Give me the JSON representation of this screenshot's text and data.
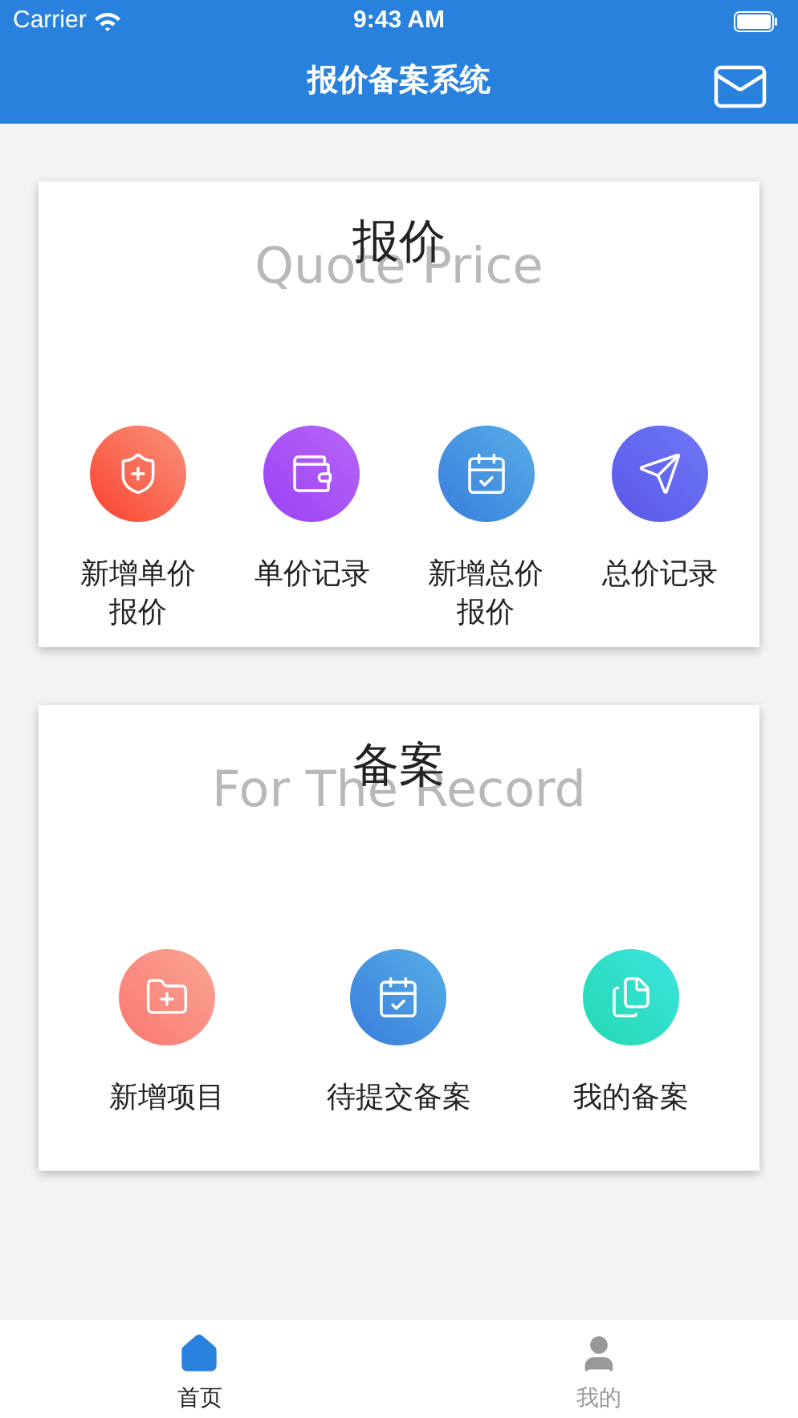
{
  "status_bar": {
    "carrier": "Carrier",
    "time": "9:43 AM"
  },
  "nav_bar": {
    "title": "报价备案系统"
  },
  "sections": [
    {
      "title": "报价",
      "subtitle": "Quote Price",
      "items": [
        {
          "label": "新增单价报价"
        },
        {
          "label": "单价记录"
        },
        {
          "label": "新增总价报价"
        },
        {
          "label": "总价记录"
        }
      ]
    },
    {
      "title": "备案",
      "subtitle": "For The Record",
      "items": [
        {
          "label": "新增项目"
        },
        {
          "label": "待提交备案"
        },
        {
          "label": "我的备案"
        }
      ]
    }
  ],
  "tab_bar": [
    {
      "label": "首页",
      "selected": true
    },
    {
      "label": "我的",
      "selected": false
    }
  ]
}
